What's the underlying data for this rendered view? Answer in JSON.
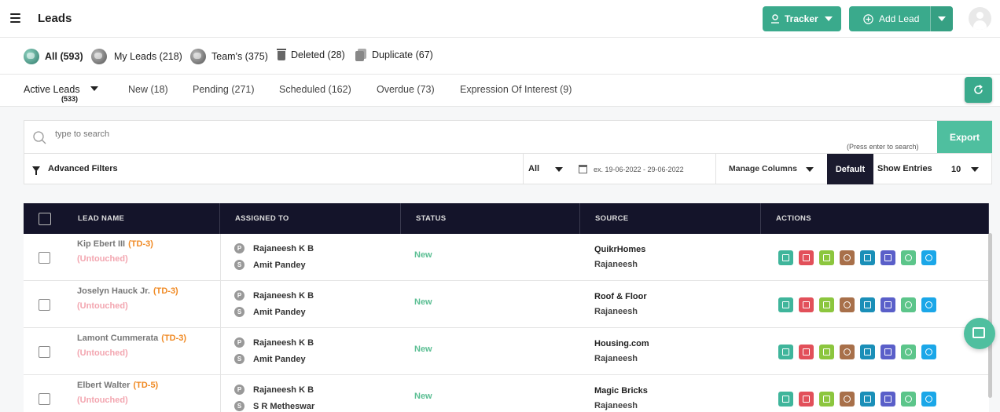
{
  "header": {
    "title": "Leads",
    "tracker_label": "Tracker",
    "add_lead_label": "Add Lead"
  },
  "filters": [
    {
      "label": "All (593)",
      "icon": "globe-icon",
      "active": true
    },
    {
      "label": "My Leads (218)",
      "icon": "globe-icon"
    },
    {
      "label": "Team's (375)",
      "icon": "globe-icon"
    },
    {
      "label": "Deleted (28)",
      "icon": "trash-icon"
    },
    {
      "label": "Duplicate (67)",
      "icon": "duplicate-icon"
    }
  ],
  "tabs": {
    "active": {
      "label": "Active Leads",
      "count": "(533)"
    },
    "items": [
      "New (18)",
      "Pending (271)",
      "Scheduled (162)",
      "Overdue (73)",
      "Expression Of Interest (9)"
    ]
  },
  "search": {
    "placeholder": "type to search",
    "hint": "(Press enter to search)",
    "export_label": "Export"
  },
  "toolbar": {
    "advanced_filters": "Advanced Filters",
    "all_value": "All",
    "date_placeholder": "ex. 19-06-2022 - 29-06-2022",
    "manage_columns": "Manage Columns",
    "default_label": "Default",
    "show_entries": "Show Entries",
    "entries_value": "10"
  },
  "table": {
    "columns": [
      "Lead Name",
      "Assigned To",
      "Status",
      "Source",
      "Actions"
    ],
    "rows": [
      {
        "name": "Kip Ebert III",
        "code": "(TD-3)",
        "state": "(Untouched)",
        "primary": "Rajaneesh K B",
        "secondary": "Amit Pandey",
        "status": "New",
        "source": "QuikrHomes",
        "source_by": "Rajaneesh"
      },
      {
        "name": "Joselyn Hauck Jr.",
        "code": "(TD-3)",
        "state": "(Untouched)",
        "primary": "Rajaneesh K B",
        "secondary": "Amit Pandey",
        "status": "New",
        "source": "Roof & Floor",
        "source_by": "Rajaneesh"
      },
      {
        "name": "Lamont Cummerata",
        "code": "(TD-3)",
        "state": "(Untouched)",
        "primary": "Rajaneesh K B",
        "secondary": "Amit Pandey",
        "status": "New",
        "source": "Housing.com",
        "source_by": "Rajaneesh"
      },
      {
        "name": "Elbert Walter",
        "code": "(TD-5)",
        "state": "(Untouched)",
        "primary": "Rajaneesh K B",
        "secondary": "S R Metheswar",
        "status": "New",
        "source": "Magic Bricks",
        "source_by": "Rajaneesh"
      }
    ],
    "badges": {
      "primary": "P",
      "secondary": "S"
    },
    "actions": [
      {
        "name": "edit-icon",
        "color": "#3fb59b"
      },
      {
        "name": "delete-icon",
        "color": "#e2505a"
      },
      {
        "name": "notes-icon",
        "color": "#8cc63e"
      },
      {
        "name": "history-icon",
        "color": "#a8704a"
      },
      {
        "name": "upload-icon",
        "color": "#1a8fb8"
      },
      {
        "name": "email-icon",
        "color": "#5a5fc9"
      },
      {
        "name": "whatsapp-icon",
        "color": "#5cc58a"
      },
      {
        "name": "phone-icon",
        "color": "#1ba7e8"
      }
    ]
  },
  "colors": {
    "accent": "#3aaa8c",
    "dark_header": "#14142a",
    "td_orange": "#f08a24",
    "untouched_pink": "#f3a6b0",
    "status_green": "#5cbf94"
  }
}
